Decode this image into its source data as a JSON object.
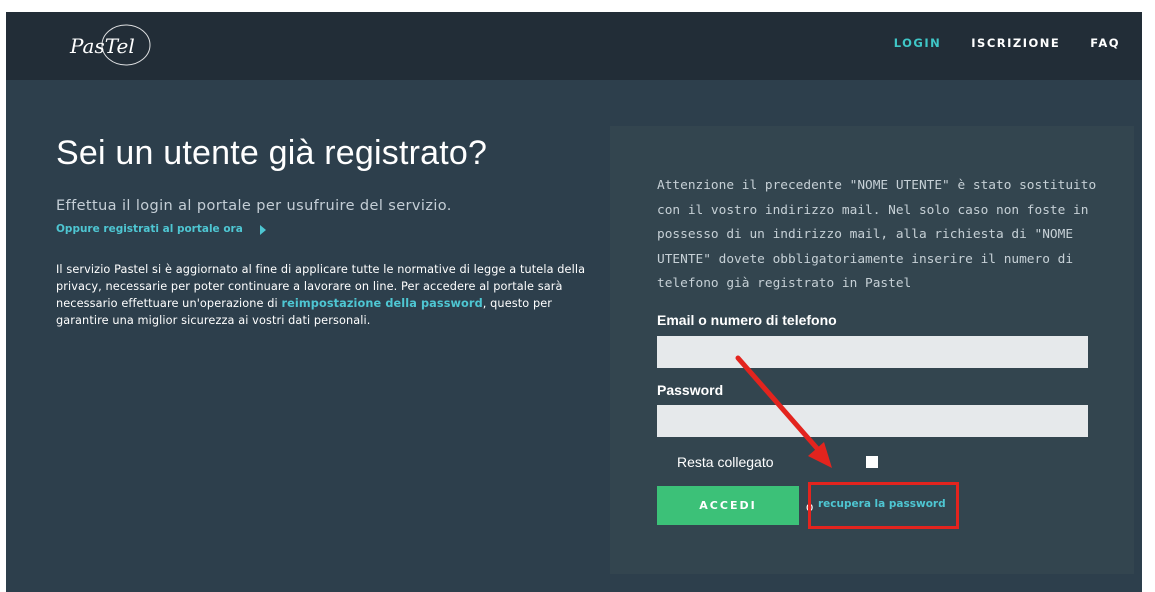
{
  "header": {
    "logo_text": "PasTel",
    "nav": [
      {
        "label": "LOGIN",
        "active": true
      },
      {
        "label": "ISCRIZIONE",
        "active": false
      },
      {
        "label": "FAQ",
        "active": false
      }
    ]
  },
  "main": {
    "title": "Sei un utente già registrato?",
    "subtitle": "Effettua il login al portale per usufruire del servizio.",
    "register_link": "Oppure registrati al portale ora",
    "info_before": "Il servizio Pastel si è aggiornato al fine di applicare tutte le normative di legge a tutela della privacy, necessarie per poter continuare a lavorare on line. Per accedere al portale sarà necessario effettuare un'operazione di ",
    "info_link": "reimpostazione della password",
    "info_after": ", questo per garantire una miglior sicurezza ai vostri dati personali."
  },
  "login_form": {
    "notice": "Attenzione il precedente \"NOME UTENTE\" è stato sostituito con il vostro indirizzo mail. Nel solo caso non foste in possesso di un indirizzo mail, alla richiesta di \"NOME UTENTE\" dovete obbligatoriamente inserire il numero di telefono già registrato in Pastel",
    "email_label": "Email o numero di telefono",
    "email_value": "",
    "password_label": "Password",
    "password_value": "",
    "remember_label": "Resta collegato",
    "remember_checked": false,
    "submit_label": "ACCEDI",
    "or_text": "o",
    "recover_link": "recupera la password"
  },
  "colors": {
    "header_bg": "#222d37",
    "page_bg": "#2d3f4c",
    "panel_bg": "#33454f",
    "accent": "#3fc7c7",
    "button": "#3cc178",
    "annotation": "#e3241e"
  },
  "icons": {
    "register_arrow": "caret-right-icon",
    "annotation_arrow": "red-arrow-icon"
  }
}
